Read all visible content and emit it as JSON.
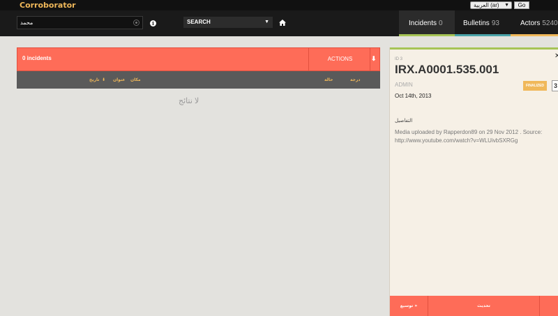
{
  "app": {
    "title": "Corroborator"
  },
  "language": {
    "selected": "العربية (ar)",
    "go_label": "Go"
  },
  "search": {
    "query": "محمد",
    "info_icon_label": "i",
    "scope": "SEARCH"
  },
  "tabs": [
    {
      "label": "Incidents",
      "count": "0",
      "underline": "#a6c456"
    },
    {
      "label": "Bulletins",
      "count": "93",
      "underline": "#4aa3a8"
    },
    {
      "label": "Actors",
      "count": "5240",
      "underline": "#f0b85a"
    }
  ],
  "incidents": {
    "count_label": "0 incidents",
    "actions_label": "ACTIONS",
    "columns": {
      "date": "تاريخ",
      "location": "مكان",
      "title": "عنوان",
      "status": "حالة",
      "score": "درجة"
    },
    "empty_message": "لا نتائج"
  },
  "detail": {
    "id_label": "ID 3",
    "reference": "IRX.A0001.535.001",
    "assigned_to": "ADMIN",
    "status": "FINALIZED",
    "score": "3",
    "date": "Oct 14th, 2013",
    "details_title": "التفاصيل",
    "description_line1": "Media uploaded by Rapperdon89 on 29 Nov 2012 . Source:",
    "description_line2": "http://www.youtube.com/watch?v=WLUivbSXRGg",
    "footer": {
      "expand_label": "توسيع »",
      "update_label": "تحديث"
    }
  },
  "colors": {
    "accent": "#fe6c58",
    "brand": "#f0b85a",
    "incidents": "#a6c456",
    "bulletins": "#4aa3a8"
  }
}
